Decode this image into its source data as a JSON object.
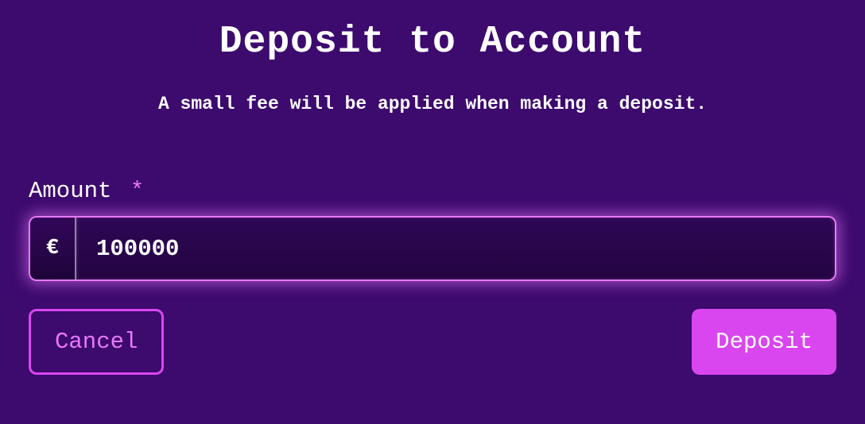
{
  "dialog": {
    "title": "Deposit to Account",
    "subtitle": "A small fee will be applied when making a deposit."
  },
  "field": {
    "label": "Amount",
    "required_mark": "*",
    "currency_symbol": "€",
    "value": "100000"
  },
  "buttons": {
    "cancel": "Cancel",
    "deposit": "Deposit"
  }
}
